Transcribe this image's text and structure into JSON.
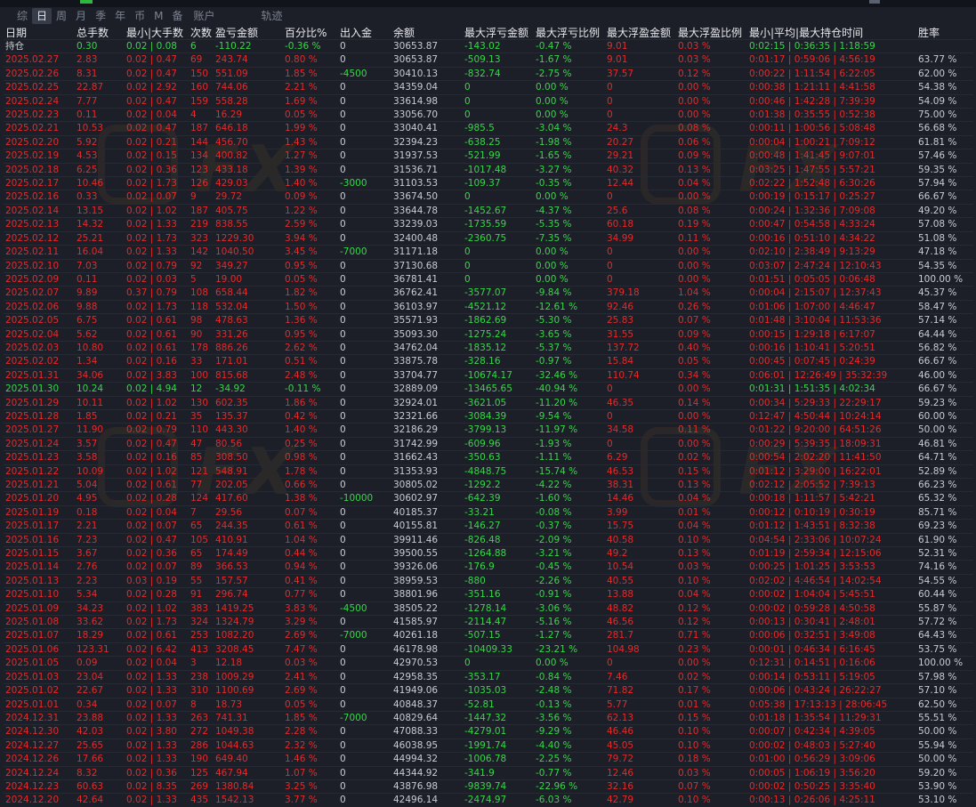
{
  "tabs": [
    "综",
    "日",
    "周",
    "月",
    "季",
    "年",
    "币",
    "M",
    "备",
    "账户",
    "轨迹"
  ],
  "active_tab": 1,
  "watermark": "FX",
  "headers": [
    "日期",
    "总手数",
    "最小|大手数",
    "次数",
    "盈亏金额",
    "百分比%",
    "出入金",
    "余额",
    "最大浮亏金额",
    "最大浮亏比例",
    "最大浮盈金额",
    "最大浮盈比例",
    "最小|平均|最大持仓时间",
    "胜率"
  ],
  "colors": {
    "profit": "#e52a2a",
    "loss": "#38d64a",
    "neutral": "#c9ccd3"
  },
  "rows": [
    {
      "s": "g",
      "c": [
        "持仓",
        "0.30",
        "0.02 | 0.08",
        "6",
        "-110.22",
        "-0.36 %",
        "0",
        "30653.87",
        "-143.02",
        "-0.47 %",
        "9.01",
        "0.03 %",
        "0:02:15 | 0:36:35 | 1:18:59",
        ""
      ]
    },
    {
      "s": "r",
      "c": [
        "2025.02.27",
        "2.83",
        "0.02 | 0.47",
        "69",
        "243.74",
        "0.80 %",
        "0",
        "30653.87",
        "-509.13",
        "-1.67 %",
        "9.01",
        "0.03 %",
        "0:01:17 | 0:59:06 | 4:56:19",
        "63.77 %"
      ]
    },
    {
      "s": "r",
      "c": [
        "2025.02.26",
        "8.31",
        "0.02 | 0.47",
        "150",
        "551.09",
        "1.85 %",
        "-4500",
        "30410.13",
        "-832.74",
        "-2.75 %",
        "37.57",
        "0.12 %",
        "0:00:22 | 1:11:54 | 6:22:05",
        "62.00 %"
      ]
    },
    {
      "s": "r",
      "c": [
        "2025.02.25",
        "22.87",
        "0.02 | 2.92",
        "160",
        "744.06",
        "2.21 %",
        "0",
        "34359.04",
        "0",
        "0.00 %",
        "0",
        "0.00 %",
        "0:00:38 | 1:21:11 | 4:41:58",
        "54.38 %"
      ]
    },
    {
      "s": "r",
      "c": [
        "2025.02.24",
        "7.77",
        "0.02 | 0.47",
        "159",
        "558.28",
        "1.69 %",
        "0",
        "33614.98",
        "0",
        "0.00 %",
        "0",
        "0.00 %",
        "0:00:46 | 1:42:28 | 7:39:39",
        "54.09 %"
      ]
    },
    {
      "s": "r",
      "c": [
        "2025.02.23",
        "0.11",
        "0.02 | 0.04",
        "4",
        "16.29",
        "0.05 %",
        "0",
        "33056.70",
        "0",
        "0.00 %",
        "0",
        "0.00 %",
        "0:01:38 | 0:35:55 | 0:52:38",
        "75.00 %"
      ]
    },
    {
      "s": "r",
      "c": [
        "2025.02.21",
        "10.53",
        "0.02 | 0.47",
        "187",
        "646.18",
        "1.99 %",
        "0",
        "33040.41",
        "-985.5",
        "-3.04 %",
        "24.3",
        "0.08 %",
        "0:00:11 | 1:00:56 | 5:08:48",
        "56.68 %"
      ]
    },
    {
      "s": "r",
      "c": [
        "2025.02.20",
        "5.92",
        "0.02 | 0.21",
        "144",
        "456.70",
        "1.43 %",
        "0",
        "32394.23",
        "-638.25",
        "-1.98 %",
        "20.27",
        "0.06 %",
        "0:00:04 | 1:00:21 | 7:09:12",
        "61.81 %"
      ]
    },
    {
      "s": "r",
      "c": [
        "2025.02.19",
        "4.53",
        "0.02 | 0.15",
        "134",
        "400.82",
        "1.27 %",
        "0",
        "31937.53",
        "-521.99",
        "-1.65 %",
        "29.21",
        "0.09 %",
        "0:00:48 | 1:41:45 | 9:07:01",
        "57.46 %"
      ]
    },
    {
      "s": "r",
      "c": [
        "2025.02.18",
        "6.25",
        "0.02 | 0.36",
        "123",
        "433.18",
        "1.39 %",
        "0",
        "31536.71",
        "-1017.48",
        "-3.27 %",
        "40.32",
        "0.13 %",
        "0:03:25 | 1:47:55 | 5:57:21",
        "59.35 %"
      ]
    },
    {
      "s": "r",
      "c": [
        "2025.02.17",
        "10.46",
        "0.02 | 1.73",
        "126",
        "429.03",
        "1.40 %",
        "-3000",
        "31103.53",
        "-109.37",
        "-0.35 %",
        "12.44",
        "0.04 %",
        "0:02:22 | 1:52:48 | 6:30:26",
        "57.94 %"
      ]
    },
    {
      "s": "r",
      "c": [
        "2025.02.16",
        "0.33",
        "0.02 | 0.07",
        "9",
        "29.72",
        "0.09 %",
        "0",
        "33674.50",
        "0",
        "0.00 %",
        "0",
        "0.00 %",
        "0:00:19 | 0:15:17 | 0:25:27",
        "66.67 %"
      ]
    },
    {
      "s": "r",
      "c": [
        "2025.02.14",
        "13.15",
        "0.02 | 1.02",
        "187",
        "405.75",
        "1.22 %",
        "0",
        "33644.78",
        "-1452.67",
        "-4.37 %",
        "25.6",
        "0.08 %",
        "0:00:24 | 1:32:36 | 7:09:08",
        "49.20 %"
      ]
    },
    {
      "s": "r",
      "c": [
        "2025.02.13",
        "14.32",
        "0.02 | 1.33",
        "219",
        "838.55",
        "2.59 %",
        "0",
        "33239.03",
        "-1735.59",
        "-5.35 %",
        "60.18",
        "0.19 %",
        "0:00:47 | 0:54:58 | 4:33:24",
        "57.08 %"
      ]
    },
    {
      "s": "r",
      "c": [
        "2025.02.12",
        "25.21",
        "0.02 | 1.73",
        "323",
        "1229.30",
        "3.94 %",
        "0",
        "32400.48",
        "-2360.75",
        "-7.35 %",
        "34.99",
        "0.11 %",
        "0:00:16 | 0:51:10 | 4:34:22",
        "51.08 %"
      ]
    },
    {
      "s": "r",
      "c": [
        "2025.02.11",
        "16.04",
        "0.02 | 1.33",
        "142",
        "1040.50",
        "3.45 %",
        "-7000",
        "31171.18",
        "0",
        "0.00 %",
        "0",
        "0.00 %",
        "0:02:10 | 2:38:49 | 9:13:29",
        "47.18 %"
      ]
    },
    {
      "s": "r",
      "c": [
        "2025.02.10",
        "7.03",
        "0.02 | 0.79",
        "92",
        "349.27",
        "0.95 %",
        "0",
        "37130.68",
        "0",
        "0.00 %",
        "0",
        "0.00 %",
        "0:03:07 | 2:47:24 | 12:10:43",
        "54.35 %"
      ]
    },
    {
      "s": "r",
      "c": [
        "2025.02.09",
        "0.11",
        "0.02 | 0.03",
        "5",
        "19.00",
        "0.05 %",
        "0",
        "36781.41",
        "0",
        "0.00 %",
        "0",
        "0.00 %",
        "0:01:51 | 0:05:05 | 0:06:48",
        "100.00 %"
      ]
    },
    {
      "s": "r",
      "c": [
        "2025.02.07",
        "9.89",
        "0.37 | 0.79",
        "108",
        "658.44",
        "1.82 %",
        "0",
        "36762.41",
        "-3577.07",
        "-9.84 %",
        "379.18",
        "1.04 %",
        "0:00:04 | 2:15:07 | 12:37:43",
        "45.37 %"
      ]
    },
    {
      "s": "r",
      "c": [
        "2025.02.06",
        "9.88",
        "0.02 | 1.73",
        "118",
        "532.04",
        "1.50 %",
        "0",
        "36103.97",
        "-4521.12",
        "-12.61 %",
        "92.46",
        "0.26 %",
        "0:01:06 | 1:07:00 | 4:46:47",
        "58.47 %"
      ]
    },
    {
      "s": "r",
      "c": [
        "2025.02.05",
        "6.75",
        "0.02 | 0.61",
        "98",
        "478.63",
        "1.36 %",
        "0",
        "35571.93",
        "-1862.69",
        "-5.30 %",
        "25.83",
        "0.07 %",
        "0:01:48 | 3:10:04 | 11:53:36",
        "57.14 %"
      ]
    },
    {
      "s": "r",
      "c": [
        "2025.02.04",
        "5.62",
        "0.02 | 0.61",
        "90",
        "331.26",
        "0.95 %",
        "0",
        "35093.30",
        "-1275.24",
        "-3.65 %",
        "31.55",
        "0.09 %",
        "0:00:15 | 1:29:18 | 6:17:07",
        "64.44 %"
      ]
    },
    {
      "s": "r",
      "c": [
        "2025.02.03",
        "10.80",
        "0.02 | 0.61",
        "178",
        "886.26",
        "2.62 %",
        "0",
        "34762.04",
        "-1835.12",
        "-5.37 %",
        "137.72",
        "0.40 %",
        "0:00:16 | 1:10:41 | 5:20:51",
        "56.82 %"
      ]
    },
    {
      "s": "r",
      "c": [
        "2025.02.02",
        "1.34",
        "0.02 | 0.16",
        "33",
        "171.01",
        "0.51 %",
        "0",
        "33875.78",
        "-328.16",
        "-0.97 %",
        "15.84",
        "0.05 %",
        "0:00:45 | 0:07:45 | 0:24:39",
        "66.67 %"
      ]
    },
    {
      "s": "r",
      "c": [
        "2025.01.31",
        "34.06",
        "0.02 | 3.83",
        "100",
        "815.68",
        "2.48 %",
        "0",
        "33704.77",
        "-10674.17",
        "-32.46 %",
        "110.74",
        "0.34 %",
        "0:06:01 | 12:26:49 | 35:32:39",
        "46.00 %"
      ]
    },
    {
      "s": "g",
      "c": [
        "2025.01.30",
        "10.24",
        "0.02 | 4.94",
        "12",
        "-34.92",
        "-0.11 %",
        "0",
        "32889.09",
        "-13465.65",
        "-40.94 %",
        "0",
        "0.00 %",
        "0:01:31 | 1:51:35 | 4:02:34",
        "66.67 %"
      ]
    },
    {
      "s": "r",
      "c": [
        "2025.01.29",
        "10.11",
        "0.02 | 1.02",
        "130",
        "602.35",
        "1.86 %",
        "0",
        "32924.01",
        "-3621.05",
        "-11.20 %",
        "46.35",
        "0.14 %",
        "0:00:34 | 5:29:33 | 22:29:17",
        "59.23 %"
      ]
    },
    {
      "s": "r",
      "c": [
        "2025.01.28",
        "1.85",
        "0.02 | 0.21",
        "35",
        "135.37",
        "0.42 %",
        "0",
        "32321.66",
        "-3084.39",
        "-9.54 %",
        "0",
        "0.00 %",
        "0:12:47 | 4:50:44 | 10:24:14",
        "60.00 %"
      ]
    },
    {
      "s": "r",
      "c": [
        "2025.01.27",
        "11.90",
        "0.02 | 0.79",
        "110",
        "443.30",
        "1.40 %",
        "0",
        "32186.29",
        "-3799.13",
        "-11.97 %",
        "34.58",
        "0.11 %",
        "0:01:22 | 9:20:00 | 64:51:26",
        "50.00 %"
      ]
    },
    {
      "s": "r",
      "c": [
        "2025.01.24",
        "3.57",
        "0.02 | 0.47",
        "47",
        "80.56",
        "0.25 %",
        "0",
        "31742.99",
        "-609.96",
        "-1.93 %",
        "0",
        "0.00 %",
        "0:00:29 | 5:39:35 | 18:09:31",
        "46.81 %"
      ]
    },
    {
      "s": "r",
      "c": [
        "2025.01.23",
        "3.58",
        "0.02 | 0.16",
        "85",
        "308.50",
        "0.98 %",
        "0",
        "31662.43",
        "-350.63",
        "-1.11 %",
        "6.29",
        "0.02 %",
        "0:00:54 | 2:02:20 | 11:41:50",
        "64.71 %"
      ]
    },
    {
      "s": "r",
      "c": [
        "2025.01.22",
        "10.09",
        "0.02 | 1.02",
        "121",
        "548.91",
        "1.78 %",
        "0",
        "31353.93",
        "-4848.75",
        "-15.74 %",
        "46.53",
        "0.15 %",
        "0:01:12 | 3:29:00 | 16:22:01",
        "52.89 %"
      ]
    },
    {
      "s": "r",
      "c": [
        "2025.01.21",
        "5.04",
        "0.02 | 0.61",
        "77",
        "202.05",
        "0.66 %",
        "0",
        "30805.02",
        "-1292.2",
        "-4.22 %",
        "38.31",
        "0.13 %",
        "0:02:12 | 2:05:52 | 7:39:13",
        "66.23 %"
      ]
    },
    {
      "s": "r",
      "c": [
        "2025.01.20",
        "4.95",
        "0.02 | 0.28",
        "124",
        "417.60",
        "1.38 %",
        "-10000",
        "30602.97",
        "-642.39",
        "-1.60 %",
        "14.46",
        "0.04 %",
        "0:00:18 | 1:11:57 | 5:42:21",
        "65.32 %"
      ]
    },
    {
      "s": "r",
      "c": [
        "2025.01.19",
        "0.18",
        "0.02 | 0.04",
        "7",
        "29.56",
        "0.07 %",
        "0",
        "40185.37",
        "-33.21",
        "-0.08 %",
        "3.99",
        "0.01 %",
        "0:00:12 | 0:10:19 | 0:30:19",
        "85.71 %"
      ]
    },
    {
      "s": "r",
      "c": [
        "2025.01.17",
        "2.21",
        "0.02 | 0.07",
        "65",
        "244.35",
        "0.61 %",
        "0",
        "40155.81",
        "-146.27",
        "-0.37 %",
        "15.75",
        "0.04 %",
        "0:01:12 | 1:43:51 | 8:32:38",
        "69.23 %"
      ]
    },
    {
      "s": "r",
      "c": [
        "2025.01.16",
        "7.23",
        "0.02 | 0.47",
        "105",
        "410.91",
        "1.04 %",
        "0",
        "39911.46",
        "-826.48",
        "-2.09 %",
        "40.58",
        "0.10 %",
        "0:04:54 | 2:33:06 | 10:07:24",
        "61.90 %"
      ]
    },
    {
      "s": "r",
      "c": [
        "2025.01.15",
        "3.67",
        "0.02 | 0.36",
        "65",
        "174.49",
        "0.44 %",
        "0",
        "39500.55",
        "-1264.88",
        "-3.21 %",
        "49.2",
        "0.13 %",
        "0:01:19 | 2:59:34 | 12:15:06",
        "52.31 %"
      ]
    },
    {
      "s": "r",
      "c": [
        "2025.01.14",
        "2.76",
        "0.02 | 0.07",
        "89",
        "366.53",
        "0.94 %",
        "0",
        "39326.06",
        "-176.9",
        "-0.45 %",
        "10.54",
        "0.03 %",
        "0:00:25 | 1:01:25 | 3:53:53",
        "74.16 %"
      ]
    },
    {
      "s": "r",
      "c": [
        "2025.01.13",
        "2.23",
        "0.03 | 0.19",
        "55",
        "157.57",
        "0.41 %",
        "0",
        "38959.53",
        "-880",
        "-2.26 %",
        "40.55",
        "0.10 %",
        "0:02:02 | 4:46:54 | 14:02:54",
        "54.55 %"
      ]
    },
    {
      "s": "r",
      "c": [
        "2025.01.10",
        "5.34",
        "0.02 | 0.28",
        "91",
        "296.74",
        "0.77 %",
        "0",
        "38801.96",
        "-351.16",
        "-0.91 %",
        "13.88",
        "0.04 %",
        "0:00:02 | 1:04:04 | 5:45:51",
        "60.44 %"
      ]
    },
    {
      "s": "r",
      "c": [
        "2025.01.09",
        "34.23",
        "0.02 | 1.02",
        "383",
        "1419.25",
        "3.83 %",
        "-4500",
        "38505.22",
        "-1278.14",
        "-3.06 %",
        "48.82",
        "0.12 %",
        "0:00:02 | 0:59:28 | 4:50:58",
        "55.87 %"
      ]
    },
    {
      "s": "r",
      "c": [
        "2025.01.08",
        "33.62",
        "0.02 | 1.73",
        "324",
        "1324.79",
        "3.29 %",
        "0",
        "41585.97",
        "-2114.47",
        "-5.16 %",
        "46.56",
        "0.12 %",
        "0:00:13 | 0:30:41 | 2:48:01",
        "57.72 %"
      ]
    },
    {
      "s": "r",
      "c": [
        "2025.01.07",
        "18.29",
        "0.02 | 0.61",
        "253",
        "1082.20",
        "2.69 %",
        "-7000",
        "40261.18",
        "-507.15",
        "-1.27 %",
        "281.7",
        "0.71 %",
        "0:00:06 | 0:32:51 | 3:49:08",
        "64.43 %"
      ]
    },
    {
      "s": "r",
      "c": [
        "2025.01.06",
        "123.31",
        "0.02 | 6.42",
        "413",
        "3208.45",
        "7.47 %",
        "0",
        "46178.98",
        "-10409.33",
        "-23.21 %",
        "104.98",
        "0.23 %",
        "0:00:01 | 0:46:34 | 6:16:45",
        "53.75 %"
      ]
    },
    {
      "s": "r",
      "c": [
        "2025.01.05",
        "0.09",
        "0.02 | 0.04",
        "3",
        "12.18",
        "0.03 %",
        "0",
        "42970.53",
        "0",
        "0.00 %",
        "0",
        "0.00 %",
        "0:12:31 | 0:14:51 | 0:16:06",
        "100.00 %"
      ]
    },
    {
      "s": "r",
      "c": [
        "2025.01.03",
        "23.04",
        "0.02 | 1.33",
        "238",
        "1009.29",
        "2.41 %",
        "0",
        "42958.35",
        "-353.17",
        "-0.84 %",
        "7.46",
        "0.02 %",
        "0:00:14 | 0:53:11 | 5:19:05",
        "57.98 %"
      ]
    },
    {
      "s": "r",
      "c": [
        "2025.01.02",
        "22.67",
        "0.02 | 1.33",
        "310",
        "1100.69",
        "2.69 %",
        "0",
        "41949.06",
        "-1035.03",
        "-2.48 %",
        "71.82",
        "0.17 %",
        "0:00:06 | 0:43:24 | 26:22:27",
        "57.10 %"
      ]
    },
    {
      "s": "r",
      "c": [
        "2025.01.01",
        "0.34",
        "0.02 | 0.07",
        "8",
        "18.73",
        "0.05 %",
        "0",
        "40848.37",
        "-52.81",
        "-0.13 %",
        "5.77",
        "0.01 %",
        "0:05:38 | 17:13:13 | 28:06:45",
        "62.50 %"
      ]
    },
    {
      "s": "r",
      "c": [
        "2024.12.31",
        "23.88",
        "0.02 | 1.33",
        "263",
        "741.31",
        "1.85 %",
        "-7000",
        "40829.64",
        "-1447.32",
        "-3.56 %",
        "62.13",
        "0.15 %",
        "0:01:18 | 1:35:54 | 11:29:31",
        "55.51 %"
      ]
    },
    {
      "s": "r",
      "c": [
        "2024.12.30",
        "42.03",
        "0.02 | 3.80",
        "272",
        "1049.38",
        "2.28 %",
        "0",
        "47088.33",
        "-4279.01",
        "-9.29 %",
        "46.46",
        "0.10 %",
        "0:00:07 | 0:42:34 | 4:39:05",
        "50.00 %"
      ]
    },
    {
      "s": "r",
      "c": [
        "2024.12.27",
        "25.65",
        "0.02 | 1.33",
        "286",
        "1044.63",
        "2.32 %",
        "0",
        "46038.95",
        "-1991.74",
        "-4.40 %",
        "45.05",
        "0.10 %",
        "0:00:02 | 0:48:03 | 5:27:40",
        "55.94 %"
      ]
    },
    {
      "s": "r",
      "c": [
        "2024.12.26",
        "17.66",
        "0.02 | 1.33",
        "190",
        "649.40",
        "1.46 %",
        "0",
        "44994.32",
        "-1006.78",
        "-2.25 %",
        "79.72",
        "0.18 %",
        "0:01:00 | 0:56:29 | 3:09:06",
        "50.00 %"
      ]
    },
    {
      "s": "r",
      "c": [
        "2024.12.24",
        "8.32",
        "0.02 | 0.36",
        "125",
        "467.94",
        "1.07 %",
        "0",
        "44344.92",
        "-341.9",
        "-0.77 %",
        "12.46",
        "0.03 %",
        "0:00:05 | 1:06:19 | 3:56:20",
        "59.20 %"
      ]
    },
    {
      "s": "r",
      "c": [
        "2024.12.23",
        "60.63",
        "0.02 | 8.35",
        "269",
        "1380.84",
        "3.25 %",
        "0",
        "43876.98",
        "-9839.74",
        "-22.96 %",
        "32.16",
        "0.07 %",
        "0:00:02 | 0:50:25 | 3:35:40",
        "53.90 %"
      ]
    },
    {
      "s": "r",
      "c": [
        "2024.12.20",
        "42.64",
        "0.02 | 1.33",
        "435",
        "1542.13",
        "3.77 %",
        "0",
        "42496.14",
        "-2474.97",
        "-6.03 %",
        "42.79",
        "0.10 %",
        "0:00:13 | 0:26:06 | 4:25:11",
        "53.10 %"
      ]
    }
  ]
}
